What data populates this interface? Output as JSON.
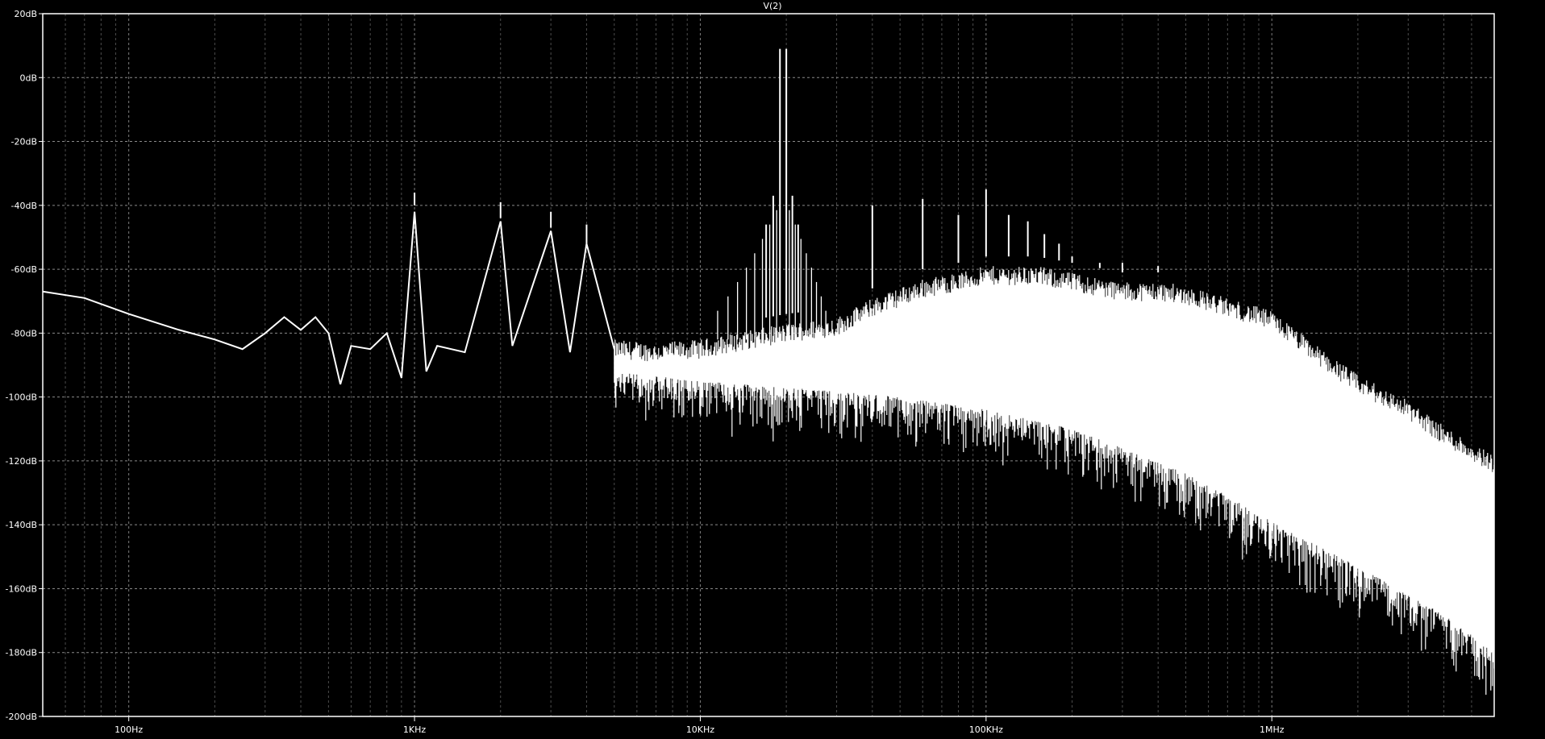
{
  "chart_data": {
    "type": "line",
    "title": "V(2)",
    "xlabel": "",
    "ylabel": "",
    "x_scale": "log",
    "xlim": [
      50,
      6000000
    ],
    "ylim": [
      -200,
      20
    ],
    "grid": true,
    "colors": {
      "background": "#000000",
      "trace": "#ffffff",
      "grid": "#8a8a8a",
      "axis": "#ffffff"
    },
    "y_ticks": [
      {
        "value": 20,
        "label": "20dB"
      },
      {
        "value": 0,
        "label": "0dB"
      },
      {
        "value": -20,
        "label": "-20dB"
      },
      {
        "value": -40,
        "label": "-40dB"
      },
      {
        "value": -60,
        "label": "-60dB"
      },
      {
        "value": -80,
        "label": "-80dB"
      },
      {
        "value": -100,
        "label": "-100dB"
      },
      {
        "value": -120,
        "label": "-120dB"
      },
      {
        "value": -140,
        "label": "-140dB"
      },
      {
        "value": -160,
        "label": "-160dB"
      },
      {
        "value": -180,
        "label": "-180dB"
      },
      {
        "value": -200,
        "label": "-200dB"
      }
    ],
    "x_ticks": [
      {
        "value": 100,
        "label": "100Hz"
      },
      {
        "value": 1000,
        "label": "1KHz"
      },
      {
        "value": 10000,
        "label": "10KHz"
      },
      {
        "value": 100000,
        "label": "100KHz"
      },
      {
        "value": 1000000,
        "label": "1MHz"
      }
    ],
    "series": [
      {
        "values_baseline": [
          [
            50,
            -67
          ],
          [
            70,
            -69
          ],
          [
            100,
            -74
          ],
          [
            150,
            -79
          ],
          [
            200,
            -82
          ],
          [
            250,
            -85
          ],
          [
            300,
            -80
          ],
          [
            350,
            -75
          ],
          [
            400,
            -79
          ],
          [
            450,
            -75
          ],
          [
            500,
            -80
          ],
          [
            550,
            -96
          ],
          [
            600,
            -84
          ],
          [
            700,
            -85
          ],
          [
            800,
            -80
          ],
          [
            900,
            -94
          ],
          [
            1000,
            -42
          ],
          [
            1100,
            -92
          ],
          [
            1200,
            -84
          ],
          [
            1500,
            -86
          ],
          [
            2000,
            -45
          ],
          [
            2200,
            -84
          ],
          [
            3000,
            -48
          ],
          [
            3500,
            -86
          ],
          [
            4000,
            -52
          ],
          [
            5000,
            -85
          ],
          [
            7000,
            -86
          ],
          [
            10000,
            -85
          ],
          [
            15000,
            -82
          ],
          [
            20000,
            -80
          ],
          [
            30000,
            -78
          ],
          [
            40000,
            -72
          ],
          [
            60000,
            -66
          ],
          [
            80000,
            -64
          ],
          [
            100000,
            -62
          ],
          [
            150000,
            -62
          ],
          [
            200000,
            -64
          ],
          [
            300000,
            -67
          ],
          [
            400000,
            -67
          ],
          [
            500000,
            -68
          ],
          [
            700000,
            -72
          ],
          [
            1000000,
            -76
          ],
          [
            1500000,
            -88
          ],
          [
            2000000,
            -96
          ],
          [
            3000000,
            -104
          ],
          [
            4000000,
            -112
          ],
          [
            6000000,
            -121
          ]
        ],
        "noise_floor": [
          [
            5000,
            -92
          ],
          [
            10000,
            -95
          ],
          [
            20000,
            -97
          ],
          [
            50000,
            -100
          ],
          [
            100000,
            -104
          ],
          [
            200000,
            -110
          ],
          [
            300000,
            -116
          ],
          [
            500000,
            -124
          ],
          [
            700000,
            -131
          ],
          [
            1000000,
            -139
          ],
          [
            2000000,
            -153
          ],
          [
            3000000,
            -162
          ],
          [
            4000000,
            -168
          ],
          [
            6000000,
            -180
          ]
        ],
        "peaks": [
          [
            1000,
            -40
          ],
          [
            2000,
            -44
          ],
          [
            3000,
            -47
          ],
          [
            4000,
            -52
          ],
          [
            19000,
            9
          ],
          [
            20000,
            9
          ],
          [
            18000,
            -37
          ],
          [
            21000,
            -37
          ],
          [
            17000,
            -46
          ],
          [
            22000,
            -46
          ],
          [
            40000,
            -40
          ],
          [
            60000,
            -38
          ],
          [
            80000,
            -43
          ],
          [
            100000,
            -35
          ],
          [
            120000,
            -43
          ],
          [
            140000,
            -45
          ],
          [
            160000,
            -49
          ],
          [
            180000,
            -52
          ],
          [
            200000,
            -56
          ],
          [
            250000,
            -58
          ],
          [
            300000,
            -58
          ],
          [
            400000,
            -59
          ]
        ]
      }
    ]
  }
}
